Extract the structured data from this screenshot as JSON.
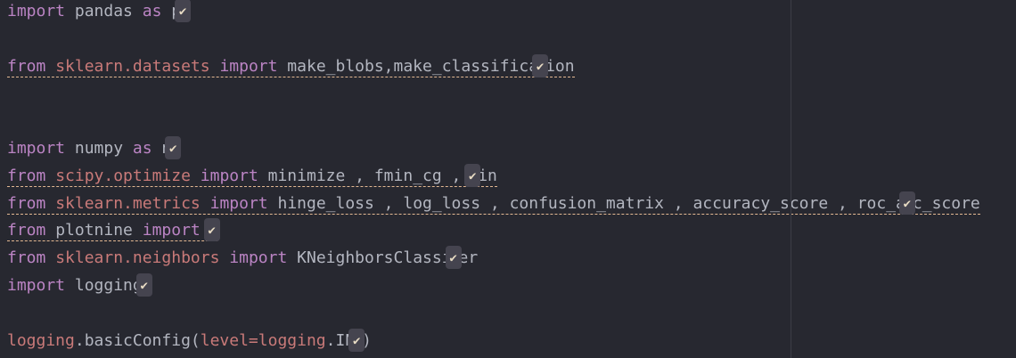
{
  "editor": {
    "check_icon": "✔",
    "colors": {
      "background": "#272830",
      "keyword": "#bb84c4",
      "module": "#c97a79",
      "text": "#b3b6c0",
      "underline": "#e3b892",
      "badge": "#45444f"
    },
    "lines": [
      {
        "underline": false,
        "tokens": [
          {
            "t": "kw",
            "v": "import"
          },
          {
            "t": "txt",
            "v": " pandas "
          },
          {
            "t": "kw",
            "v": "as"
          },
          {
            "t": "txt",
            "v": " p"
          },
          {
            "t": "badge"
          }
        ]
      },
      {
        "underline": false,
        "tokens": []
      },
      {
        "underline": true,
        "tokens": [
          {
            "t": "kw",
            "v": "from"
          },
          {
            "t": "txt",
            "v": " "
          },
          {
            "t": "mod",
            "v": "sklearn.datasets"
          },
          {
            "t": "txt",
            "v": " "
          },
          {
            "t": "kw",
            "v": "import"
          },
          {
            "t": "txt",
            "v": " make_blobs,make_classifica"
          },
          {
            "t": "badge"
          },
          {
            "t": "txt",
            "v": "ion"
          }
        ]
      },
      {
        "underline": false,
        "tokens": []
      },
      {
        "underline": false,
        "tokens": []
      },
      {
        "underline": false,
        "tokens": [
          {
            "t": "kw",
            "v": "import"
          },
          {
            "t": "txt",
            "v": " numpy "
          },
          {
            "t": "kw",
            "v": "as"
          },
          {
            "t": "txt",
            "v": " n"
          },
          {
            "t": "badge"
          }
        ]
      },
      {
        "underline": true,
        "tokens": [
          {
            "t": "kw",
            "v": "from"
          },
          {
            "t": "txt",
            "v": " "
          },
          {
            "t": "mod",
            "v": "scipy.optimize"
          },
          {
            "t": "txt",
            "v": " "
          },
          {
            "t": "kw",
            "v": "import"
          },
          {
            "t": "txt",
            "v": " minimize , fmin_cg , "
          },
          {
            "t": "badge"
          },
          {
            "t": "txt",
            "v": "in"
          }
        ]
      },
      {
        "underline": true,
        "tokens": [
          {
            "t": "kw",
            "v": "from"
          },
          {
            "t": "txt",
            "v": " "
          },
          {
            "t": "mod",
            "v": "sklearn.metrics"
          },
          {
            "t": "txt",
            "v": " "
          },
          {
            "t": "kw",
            "v": "import"
          },
          {
            "t": "txt",
            "v": " hinge_loss , log_loss , confusion_matrix , accuracy_score , roc_a"
          },
          {
            "t": "badge"
          },
          {
            "t": "txt",
            "v": "c_score"
          }
        ]
      },
      {
        "underline": true,
        "tokens": [
          {
            "t": "kw",
            "v": "from"
          },
          {
            "t": "txt",
            "v": " plotnine "
          },
          {
            "t": "kw",
            "v": "import"
          },
          {
            "t": "txt",
            "v": " "
          },
          {
            "t": "badge"
          }
        ]
      },
      {
        "underline": false,
        "tokens": [
          {
            "t": "kw",
            "v": "from"
          },
          {
            "t": "txt",
            "v": " "
          },
          {
            "t": "mod",
            "v": "sklearn.neighbors"
          },
          {
            "t": "txt",
            "v": " "
          },
          {
            "t": "kw",
            "v": "import"
          },
          {
            "t": "txt",
            "v": " KNeighborsClassi"
          },
          {
            "t": "badge"
          },
          {
            "t": "txt",
            "v": "er"
          }
        ]
      },
      {
        "underline": false,
        "tokens": [
          {
            "t": "kw",
            "v": "import"
          },
          {
            "t": "txt",
            "v": " logging"
          },
          {
            "t": "badge"
          }
        ]
      },
      {
        "underline": false,
        "tokens": []
      },
      {
        "underline": false,
        "tokens": [
          {
            "t": "mod",
            "v": "logging"
          },
          {
            "t": "txt",
            "v": ".basicConfig("
          },
          {
            "t": "mod",
            "v": "level=logging"
          },
          {
            "t": "txt",
            "v": ".IN"
          },
          {
            "t": "badge"
          },
          {
            "t": "txt",
            "v": ")"
          }
        ]
      }
    ]
  }
}
